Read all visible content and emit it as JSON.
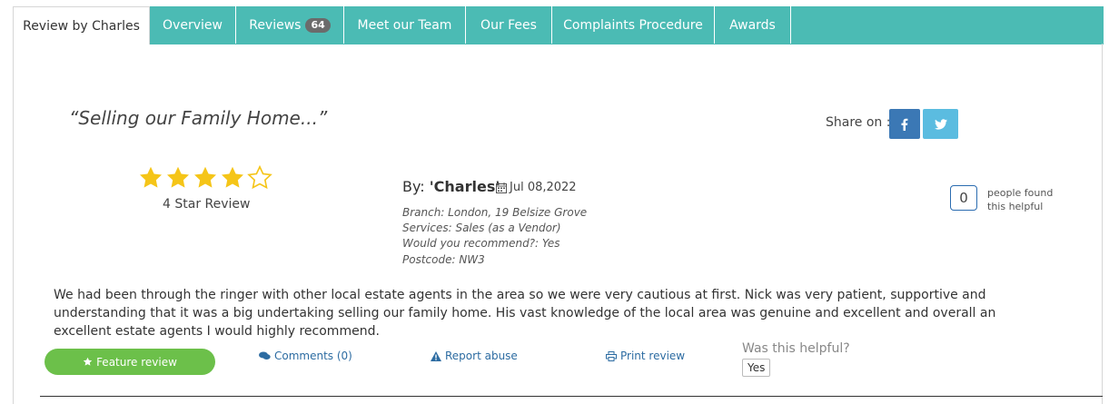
{
  "tabs": [
    {
      "label": "Review by Charles",
      "active": true
    },
    {
      "label": "Overview"
    },
    {
      "label": "Reviews",
      "badge": "64"
    },
    {
      "label": "Meet our Team"
    },
    {
      "label": "Our Fees"
    },
    {
      "label": "Complaints Procedure"
    },
    {
      "label": "Awards"
    }
  ],
  "review": {
    "title": "“Selling our Family Home...”",
    "share_label": "Share on :",
    "share_icons": [
      "facebook-icon",
      "twitter-icon"
    ],
    "rating": 4,
    "rating_max": 5,
    "rating_label": "4 Star Review",
    "by_prefix": "By:",
    "author": "'Charles'",
    "date": "Jul 08,2022",
    "branch": "Branch: London, 19 Belsize Grove",
    "services": "Services: Sales (as a Vendor)",
    "recommend": "Would you recommend?: Yes",
    "postcode": "Postcode: NW3",
    "helpful_count": "0",
    "helpful_text": "people found this helpful",
    "body": "We had been through the ringer with other local estate agents in the area so we were very cautious at first. Nick was very patient, supportive and understanding that it was a big undertaking selling our family home. His vast knowledge of the local area was genuine and excellent and overall an excellent estate agents I would highly recommend."
  },
  "actions": {
    "feature": "Feature review",
    "comments": "Comments (0)",
    "report": "Report abuse",
    "print": "Print review",
    "was_helpful": "Was this helpful?",
    "yes": "Yes"
  },
  "colors": {
    "tab_bar": "#4bbbb4",
    "star": "#f5c518",
    "feature_button": "#6cc04a",
    "link": "#2d6ca2",
    "facebook": "#3b78b5",
    "twitter": "#5bbce0"
  }
}
